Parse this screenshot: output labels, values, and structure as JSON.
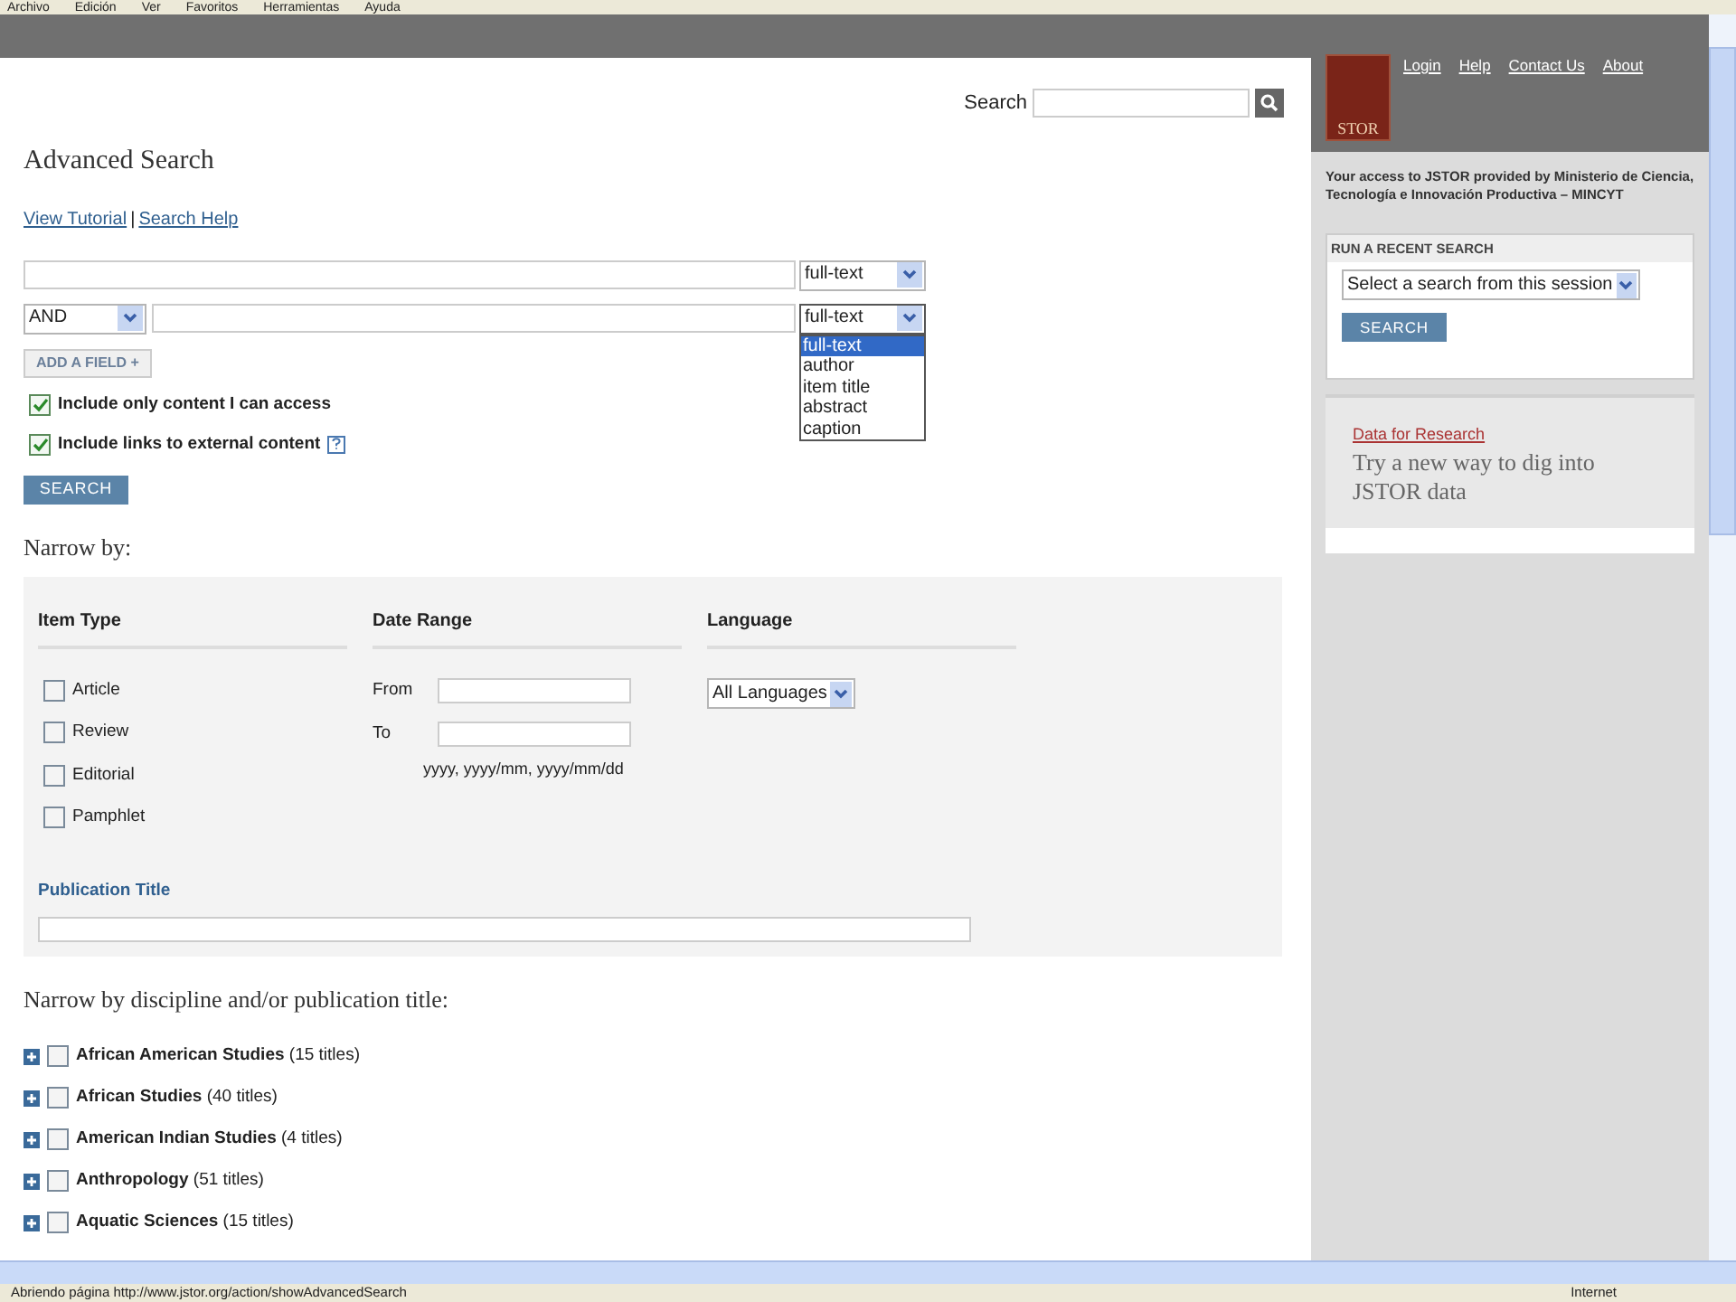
{
  "menu_bar": [
    "Archivo",
    "Edición",
    "Ver",
    "Favoritos",
    "Herramientas",
    "Ayuda"
  ],
  "top_search": {
    "label": "Search"
  },
  "header_links": [
    "Login",
    "Help",
    "Contact Us",
    "About"
  ],
  "logo": {
    "text": "STOR"
  },
  "title": "Advanced Search",
  "help_links": [
    "View Tutorial",
    "Search Help"
  ],
  "link_separator": "|",
  "query_rows": [
    {
      "operator": "",
      "field": "full-text",
      "dropdown_open": false
    },
    {
      "operator": "AND",
      "field": "full-text",
      "dropdown_open": true
    }
  ],
  "field_options": [
    {
      "label": "full-text",
      "selected": true
    },
    {
      "label": "author",
      "selected": false
    },
    {
      "label": "item title",
      "selected": false
    },
    {
      "label": "abstract",
      "selected": false
    },
    {
      "label": "caption",
      "selected": false
    }
  ],
  "add_field": "ADD A FIELD +",
  "options": [
    {
      "label": "Include only content I can access",
      "checked": true,
      "help": false
    },
    {
      "label": "Include links to external content",
      "checked": true,
      "help": true
    }
  ],
  "search_button": "SEARCH",
  "narrow_title": "Narrow by:",
  "narrow": {
    "item_type": {
      "heading": "Item Type",
      "items": [
        {
          "label": "Article",
          "checked": false
        },
        {
          "label": "Review",
          "checked": false
        },
        {
          "label": "Editorial",
          "checked": false
        },
        {
          "label": "Pamphlet",
          "checked": false
        }
      ]
    },
    "date_range": {
      "heading": "Date Range",
      "from": "From",
      "to": "To",
      "hint": "yyyy, yyyy/mm, yyyy/mm/dd"
    },
    "language": {
      "heading": "Language",
      "value": "All Languages"
    },
    "publication_title": "Publication Title"
  },
  "discipline_title": "Narrow by discipline and/or publication title:",
  "disciplines": [
    {
      "label": "**African American Studies** (15 titles)",
      "checked": false,
      "expanded": false
    },
    {
      "label": "**African Studies** (40 titles)",
      "checked": false,
      "expanded": false
    },
    {
      "label": "**American Indian Studies** (4 titles)",
      "checked": false,
      "expanded": false
    },
    {
      "label": "**Anthropology** (51 titles)",
      "checked": false,
      "expanded": false
    },
    {
      "label": "**Aquatic Sciences** (15 titles)",
      "checked": false,
      "expanded": false
    }
  ],
  "sidebar": {
    "access_text": "Your access to JSTOR provided by Ministerio de Ciencia, Tecnología e Innovación Productiva – MINCYT",
    "recent": {
      "heading": "RUN A RECENT SEARCH",
      "select": "Select a search from this session",
      "button": "SEARCH"
    },
    "promo": {
      "link": "Data for Research",
      "text": "Try a new way to dig into JSTOR data"
    }
  },
  "status_bar": {
    "text": "Abriendo página http://www.jstor.org/action/showAdvancedSearch",
    "zone": "Internet"
  }
}
